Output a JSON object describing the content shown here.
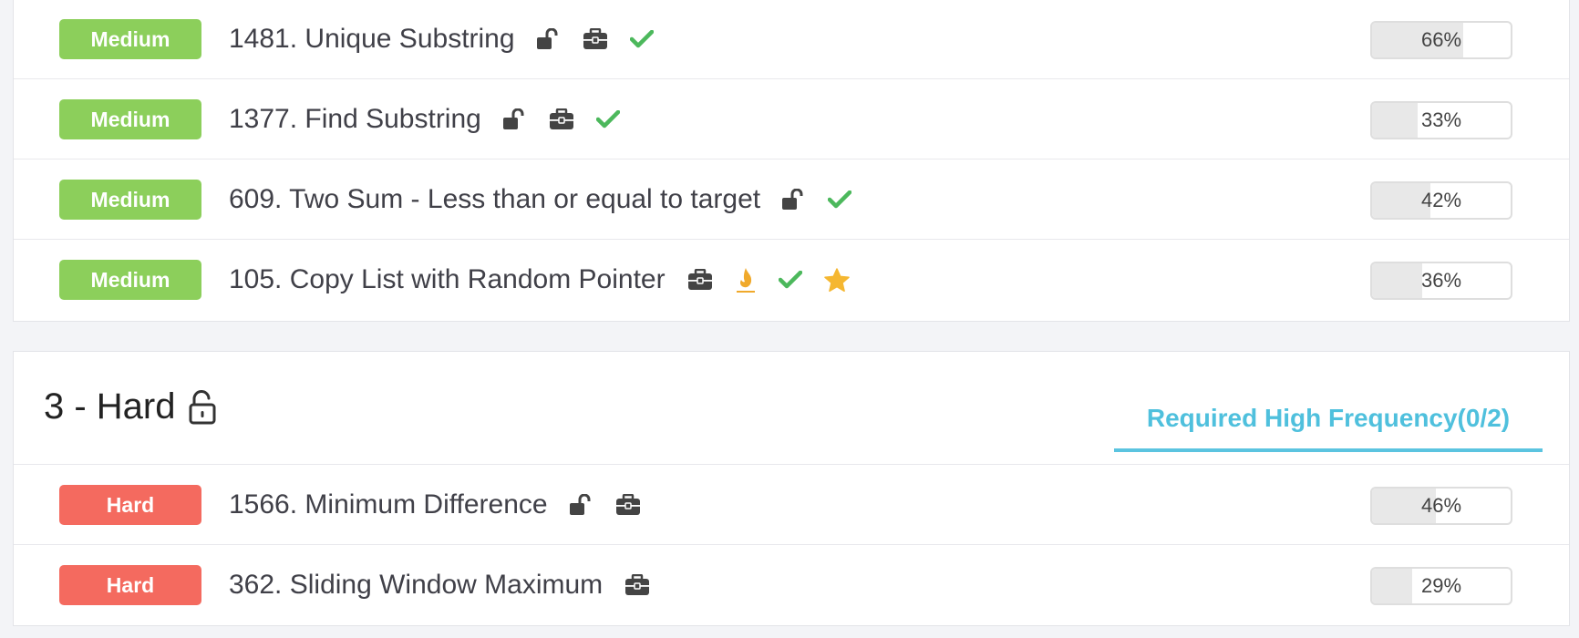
{
  "colors": {
    "medium": "#8ccf5b",
    "hard": "#f46a5f",
    "accent": "#4fc0dd",
    "check": "#4cb85c",
    "star": "#f5b731",
    "flame": "#f0a92b"
  },
  "top_rows": [
    {
      "difficulty": "Medium",
      "title": "1481. Unique Substring",
      "icons": [
        "unlock-icon",
        "briefcase-icon",
        "check-icon"
      ],
      "progress": 66,
      "progress_label": "66%"
    },
    {
      "difficulty": "Medium",
      "title": "1377. Find Substring",
      "icons": [
        "unlock-icon",
        "briefcase-icon",
        "check-icon"
      ],
      "progress": 33,
      "progress_label": "33%"
    },
    {
      "difficulty": "Medium",
      "title": "609. Two Sum - Less than or equal to target",
      "icons": [
        "unlock-icon",
        "check-icon"
      ],
      "progress": 42,
      "progress_label": "42%"
    },
    {
      "difficulty": "Medium",
      "title": "105. Copy List with Random Pointer",
      "icons": [
        "briefcase-icon",
        "flame-icon",
        "check-icon",
        "star-icon"
      ],
      "progress": 36,
      "progress_label": "36%"
    }
  ],
  "hard_section": {
    "title": "3 - Hard",
    "title_icon": "padlock-open-icon",
    "tab_label": "Required High Frequency(0/2)",
    "rows": [
      {
        "difficulty": "Hard",
        "title": "1566. Minimum Difference",
        "icons": [
          "unlock-icon",
          "briefcase-icon"
        ],
        "progress": 46,
        "progress_label": "46%"
      },
      {
        "difficulty": "Hard",
        "title": "362. Sliding Window Maximum",
        "icons": [
          "briefcase-icon"
        ],
        "progress": 29,
        "progress_label": "29%"
      }
    ]
  }
}
